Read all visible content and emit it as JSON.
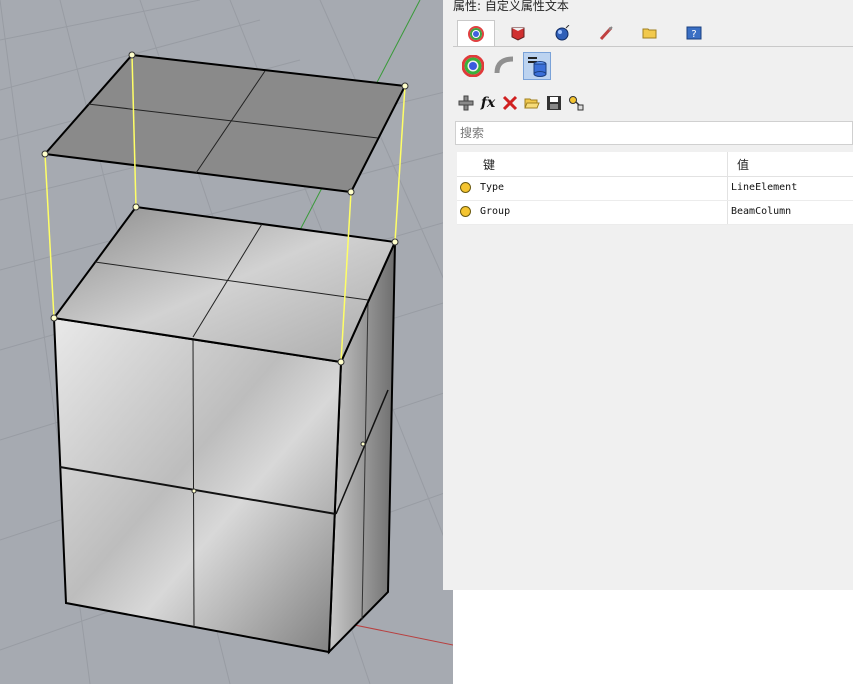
{
  "panel": {
    "title": "属性: 自定义属性文本",
    "tabs": [
      {
        "icon": "material-icon"
      },
      {
        "icon": "render-icon"
      },
      {
        "icon": "environment-icon"
      },
      {
        "icon": "paint-icon"
      },
      {
        "icon": "folder-icon"
      },
      {
        "icon": "help-icon"
      }
    ],
    "subtabs": [
      {
        "icon": "color-wheel-icon"
      },
      {
        "icon": "curve-icon"
      },
      {
        "icon": "database-icon"
      }
    ],
    "toolbar": [
      {
        "icon": "add-icon"
      },
      {
        "icon": "fx-icon",
        "label": "fx"
      },
      {
        "icon": "delete-icon"
      },
      {
        "icon": "open-folder-icon"
      },
      {
        "icon": "save-icon"
      },
      {
        "icon": "link-icon"
      }
    ],
    "search": {
      "placeholder": "搜索",
      "value": ""
    },
    "table": {
      "headers": {
        "key": "键",
        "value": "值"
      },
      "rows": [
        {
          "key": "Type",
          "value": "LineElement"
        },
        {
          "key": "Group",
          "value": "BeamColumn"
        }
      ]
    },
    "colors": {
      "accent": "#7aa2d8",
      "dot": "#f4c430",
      "viewport": "#a6aab1",
      "edge_highlight": "#ffff66"
    }
  }
}
